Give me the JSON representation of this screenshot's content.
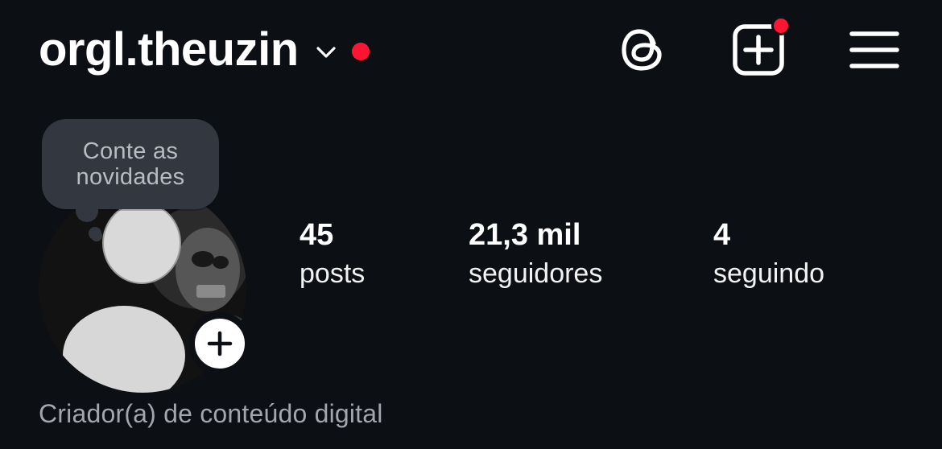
{
  "header": {
    "username": "orgl.theuzin",
    "icons": {
      "chevron": "chevron-down-icon",
      "threads": "threads-icon",
      "create": "create-post-icon",
      "menu": "hamburger-menu-icon"
    },
    "notification_color": "#ff1434"
  },
  "profile": {
    "note_text": "Conte as novidades",
    "note_line1": "Conte as",
    "note_line2": "novidades",
    "stats": [
      {
        "value": "45",
        "label": "posts"
      },
      {
        "value": "21,3 mil",
        "label": "seguidores"
      },
      {
        "value": "4",
        "label": "seguindo"
      }
    ],
    "category": "Criador(a) de conteúdo digital"
  },
  "colors": {
    "background": "#0c0f14",
    "text": "#ffffff",
    "muted": "#a3a6ac",
    "bubble": "#33373f"
  }
}
